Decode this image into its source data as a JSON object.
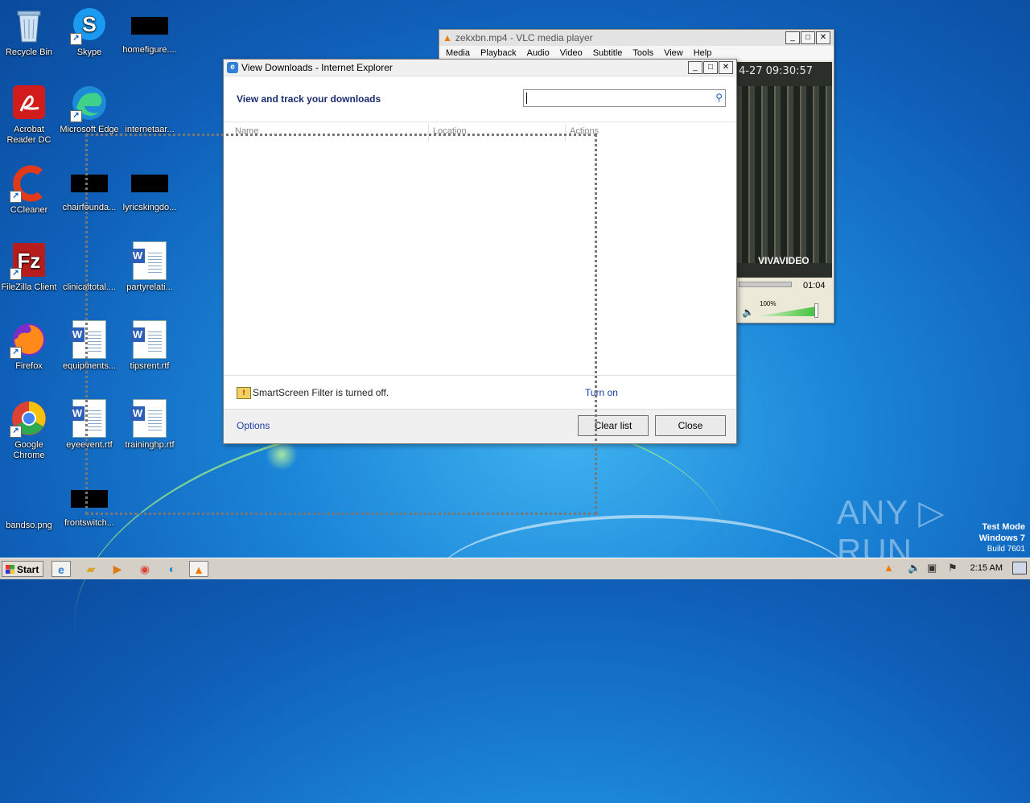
{
  "desktop": {
    "icons": [
      {
        "label": "Recycle Bin"
      },
      {
        "label": "Skype"
      },
      {
        "label": "homefigure...."
      },
      {
        "label": "Acrobat Reader DC"
      },
      {
        "label": "Microsoft Edge"
      },
      {
        "label": "internetaar..."
      },
      {
        "label": "CCleaner"
      },
      {
        "label": "chairfounda..."
      },
      {
        "label": "lyricskingdo..."
      },
      {
        "label": "FileZilla Client"
      },
      {
        "label": "clinicaltotal...."
      },
      {
        "label": "partyrelati..."
      },
      {
        "label": "Firefox"
      },
      {
        "label": "equipments..."
      },
      {
        "label": "tipsrent.rtf"
      },
      {
        "label": "Google Chrome"
      },
      {
        "label": "eyeevent.rtf"
      },
      {
        "label": "traininghp.rtf"
      },
      {
        "label": "bandso.png"
      },
      {
        "label": "frontswitch..."
      }
    ]
  },
  "vlc": {
    "title": "zekxbn.mp4 - VLC media player",
    "menu": [
      "Media",
      "Playback",
      "Audio",
      "Video",
      "Subtitle",
      "Tools",
      "View",
      "Help"
    ],
    "timestamp": "4-27  09:30:57",
    "watermark": "VIVAVIDEO",
    "time": "01:04",
    "volume": "100%",
    "volume_level": 1.0
  },
  "ie": {
    "title": "View Downloads - Internet Explorer",
    "header": "View and track your downloads",
    "search_value": "",
    "columns": [
      "Name",
      "Location",
      "Actions"
    ],
    "smartscreen_text": "SmartScreen Filter is turned off.",
    "turn_on": "Turn on",
    "options": "Options",
    "clear_list": "Clear list",
    "close": "Close"
  },
  "watermark": {
    "brand": "ANY ▷ RUN",
    "mode": "Test Mode",
    "os": "Windows 7",
    "build": "Build 7601"
  },
  "taskbar": {
    "start": "Start",
    "clock": "2:15 AM"
  },
  "colors": {
    "desktop_bg": "#1b86d8",
    "link": "#1a3fa8",
    "header": "#1a2d6e"
  }
}
